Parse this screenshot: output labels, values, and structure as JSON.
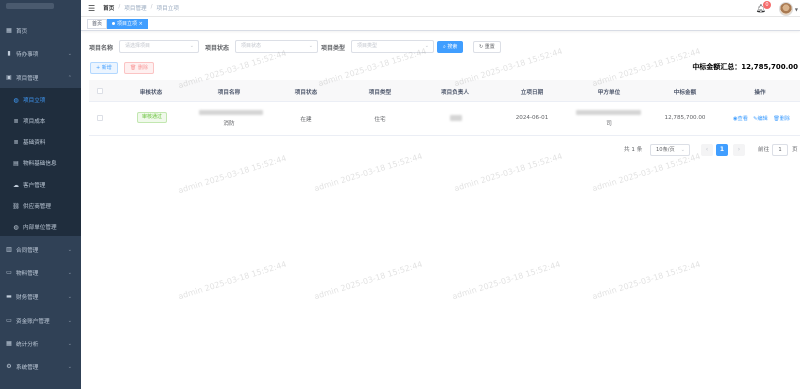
{
  "sidebar": {
    "items": [
      {
        "label": "首页",
        "icon": "dashboard-icon"
      },
      {
        "label": "待办事项",
        "icon": "bar-chart-icon"
      },
      {
        "label": "项目管理",
        "icon": "project-icon"
      },
      {
        "label": "项目立项",
        "icon": "globe-icon"
      },
      {
        "label": "项目成本",
        "icon": "list-icon"
      },
      {
        "label": "基础资料",
        "icon": "list-icon"
      },
      {
        "label": "物料基础信息",
        "icon": "document-icon"
      },
      {
        "label": "客户管理",
        "icon": "cloud-icon"
      },
      {
        "label": "供应商管理",
        "icon": "link-icon"
      },
      {
        "label": "内部单位管理",
        "icon": "globe-icon"
      },
      {
        "label": "合同管理",
        "icon": "chart-icon"
      },
      {
        "label": "物料管理",
        "icon": "monitor-icon"
      },
      {
        "label": "财务管理",
        "icon": "wallet-icon"
      },
      {
        "label": "资金账户管理",
        "icon": "card-icon"
      },
      {
        "label": "统计分析",
        "icon": "stats-icon"
      },
      {
        "label": "系统管理",
        "icon": "gear-icon"
      }
    ]
  },
  "header": {
    "breadcrumbs": [
      "首页",
      "项目管理",
      "项目立项"
    ],
    "notification_count": "0"
  },
  "tags": [
    {
      "label": "首页"
    },
    {
      "label": "项目立项"
    }
  ],
  "search": {
    "name_label": "项目名称",
    "name_placeholder": "请选择项目",
    "status_label": "项目状态",
    "status_placeholder": "项目状态",
    "type_label": "项目类型",
    "type_placeholder": "项目类型",
    "search_button": "搜索",
    "reset_button": "重置"
  },
  "toolbar": {
    "add_button": "新增",
    "delete_button": "删除"
  },
  "summary": {
    "total_text": "中标金额汇总：12,785,700.00"
  },
  "table": {
    "headers": [
      "审核状态",
      "项目名称",
      "项目状态",
      "项目类型",
      "项目负责人",
      "立项日期",
      "甲方单位",
      "中标金额",
      "操作"
    ],
    "rows": [
      {
        "audit_status": "审核通过",
        "project_name_suffix": "消防",
        "project_status": "在建",
        "project_type": "住宅",
        "date": "2024-06-01",
        "party_a_suffix": "司",
        "amount": "12,785,700.00",
        "actions": [
          "查看",
          "编辑",
          "删除"
        ]
      }
    ]
  },
  "pagination": {
    "total": "共 1 条",
    "page_size": "10条/页",
    "current_page": "1",
    "goto_label": "前往",
    "goto_value": "1",
    "page_unit": "页"
  },
  "watermark": "admin 2025-03-18 15:52:44",
  "colors": {
    "sidebar_bg": "#304156",
    "submenu_bg": "#1f2d3d",
    "primary": "#409eff",
    "success": "#67c23a",
    "danger": "#f56c6c"
  }
}
